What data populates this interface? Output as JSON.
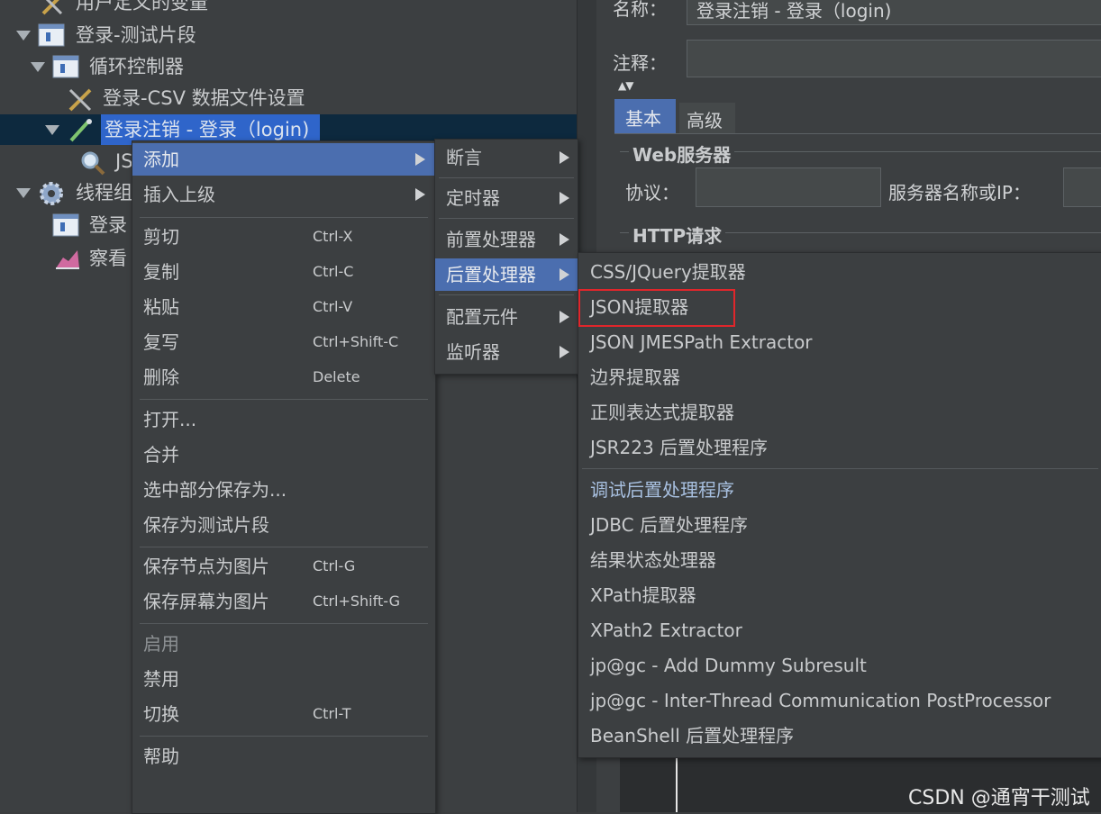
{
  "tree": {
    "items": [
      {
        "label": "用户定义的变量"
      },
      {
        "label": "登录-测试片段"
      },
      {
        "label": "循环控制器"
      },
      {
        "label": "登录-CSV 数据文件设置"
      },
      {
        "label": "登录注销 - 登录（login)"
      },
      {
        "label": "JS"
      },
      {
        "label": "线程组"
      },
      {
        "label": "登录"
      },
      {
        "label": "察看"
      }
    ]
  },
  "right_panel": {
    "name_label": "名称：",
    "name_value": "登录注销 - 登录（login)",
    "comment_label": "注释：",
    "tabs": [
      "基本",
      "高级"
    ],
    "web_server_title": "Web服务器",
    "protocol_label": "协议：",
    "server_label": "服务器名称或IP：",
    "http_request_title": "HTTP请求"
  },
  "context_menu": {
    "items": [
      {
        "label": "添加",
        "shortcut": ""
      },
      {
        "label": "插入上级",
        "shortcut": ""
      },
      {
        "label": "剪切",
        "shortcut": "Ctrl-X"
      },
      {
        "label": "复制",
        "shortcut": "Ctrl-C"
      },
      {
        "label": "粘贴",
        "shortcut": "Ctrl-V"
      },
      {
        "label": "复写",
        "shortcut": "Ctrl+Shift-C"
      },
      {
        "label": "删除",
        "shortcut": "Delete"
      },
      {
        "label": "打开...",
        "shortcut": ""
      },
      {
        "label": "合并",
        "shortcut": ""
      },
      {
        "label": "选中部分保存为...",
        "shortcut": ""
      },
      {
        "label": "保存为测试片段",
        "shortcut": ""
      },
      {
        "label": "保存节点为图片",
        "shortcut": "Ctrl-G"
      },
      {
        "label": "保存屏幕为图片",
        "shortcut": "Ctrl+Shift-G"
      },
      {
        "label": "启用",
        "shortcut": ""
      },
      {
        "label": "禁用",
        "shortcut": ""
      },
      {
        "label": "切换",
        "shortcut": "Ctrl-T"
      },
      {
        "label": "帮助",
        "shortcut": ""
      }
    ]
  },
  "add_submenu": {
    "items": [
      {
        "label": "断言"
      },
      {
        "label": "定时器"
      },
      {
        "label": "前置处理器"
      },
      {
        "label": "后置处理器"
      },
      {
        "label": "配置元件"
      },
      {
        "label": "监听器"
      }
    ]
  },
  "postprocessor_submenu": {
    "items": [
      {
        "label": "CSS/JQuery提取器"
      },
      {
        "label": "JSON提取器"
      },
      {
        "label": "JSON JMESPath Extractor"
      },
      {
        "label": "边界提取器"
      },
      {
        "label": "正则表达式提取器"
      },
      {
        "label": "JSR223 后置处理程序"
      },
      {
        "label": "调试后置处理程序"
      },
      {
        "label": "JDBC 后置处理程序"
      },
      {
        "label": "结果状态处理器"
      },
      {
        "label": "XPath提取器"
      },
      {
        "label": "XPath2 Extractor"
      },
      {
        "label": "jp@gc - Add Dummy Subresult"
      },
      {
        "label": "jp@gc - Inter-Thread Communication PostProcessor"
      },
      {
        "label": "BeanShell 后置处理程序"
      }
    ]
  },
  "watermark": "CSDN @通宵干测试",
  "colors": {
    "background": "#3c3f41",
    "selection": "#4b6eaf",
    "highlight_box": "#e0262b"
  }
}
